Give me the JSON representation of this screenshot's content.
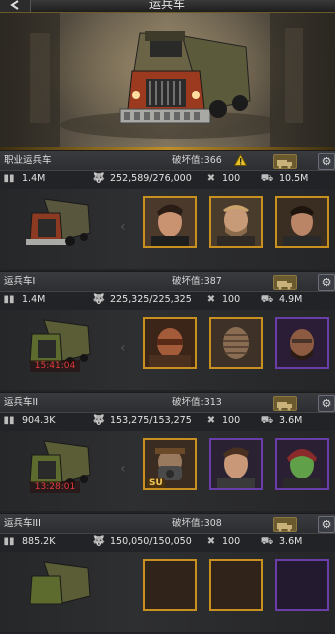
{
  "header": {
    "title": "运兵车",
    "back_label": ""
  },
  "colors": {
    "accent": "#c08f28",
    "timer": "#e23b3b",
    "gold_frame": "#b77a1f",
    "purple_frame": "#6a3ea8"
  },
  "sections": [
    {
      "name": "职业运兵车",
      "damage": "破坏值:366",
      "has_warning": true,
      "power": "1.4M",
      "troops": "252,589/276,000",
      "durability": "100",
      "load": "10.5M",
      "timer": "",
      "portraits": [
        "hero-slicked-hair",
        "hero-blond-bearded",
        "hero-dark-hair"
      ],
      "frames": [
        "gold",
        "gold",
        "gold"
      ]
    },
    {
      "name": "运兵车I",
      "damage": "破坏值:387",
      "has_warning": false,
      "power": "1.4M",
      "troops": "225,325/225,325",
      "durability": "100",
      "load": "4.9M",
      "timer": "15:41:04",
      "portraits": [
        "hero-masked-warrior",
        "hero-mummy",
        "hero-bald-bearded"
      ],
      "frames": [
        "gold",
        "gold",
        "purple"
      ]
    },
    {
      "name": "运兵车II",
      "damage": "破坏值:313",
      "has_warning": false,
      "power": "904.3K",
      "troops": "153,275/153,275",
      "durability": "100",
      "load": "3.6M",
      "timer": "13:28:01",
      "portraits": [
        "hero-gas-mask",
        "hero-young-man",
        "hero-green-skin"
      ],
      "frames": [
        "gold",
        "purple",
        "purple"
      ],
      "medal": "SU"
    },
    {
      "name": "运兵车III",
      "damage": "破坏值:308",
      "has_warning": false,
      "power": "885.2K",
      "troops": "150,050/150,050",
      "durability": "100",
      "load": "3.6M",
      "timer": "",
      "portraits": [],
      "frames": []
    }
  ]
}
